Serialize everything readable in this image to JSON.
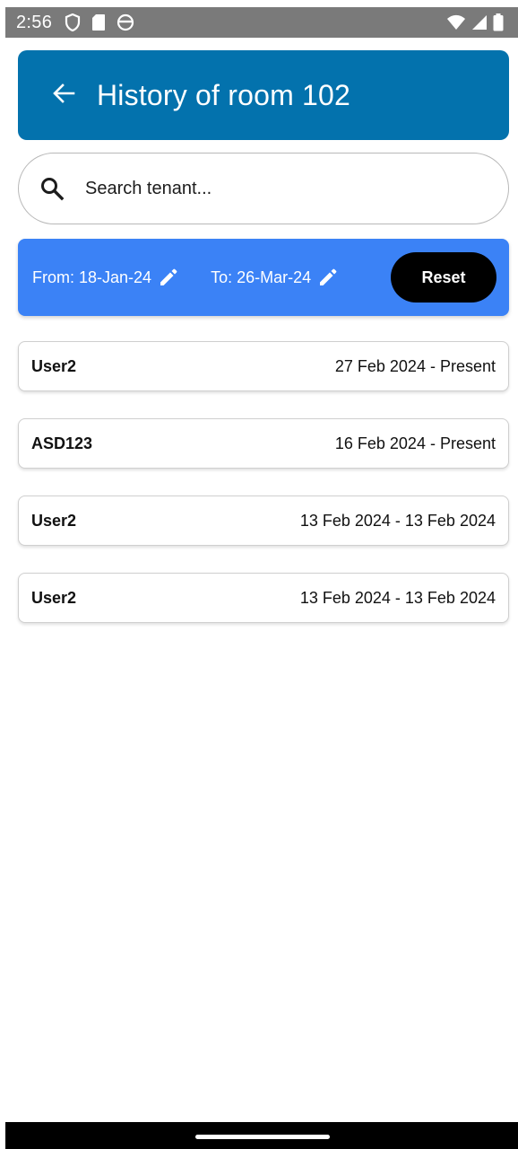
{
  "status_bar": {
    "time": "2:56",
    "left_icons": [
      "shield-icon",
      "sd-card-icon",
      "circle-face-icon"
    ],
    "right_icons": [
      "wifi-icon",
      "signal-icon",
      "battery-icon"
    ]
  },
  "app_bar": {
    "title": "History of room 102",
    "back_icon": "arrow-back-icon",
    "color": "#0372ad"
  },
  "search": {
    "placeholder": "Search tenant...",
    "value": "",
    "icon": "search-icon"
  },
  "filter": {
    "from_label": "From: 18-Jan-24",
    "to_label": "To: 26-Mar-24",
    "reset_label": "Reset",
    "background": "#3b82f6"
  },
  "tenants": [
    {
      "name": "User2",
      "range": "27 Feb 2024 - Present"
    },
    {
      "name": "ASD123",
      "range": "16 Feb 2024 - Present"
    },
    {
      "name": "User2",
      "range": "13 Feb 2024 - 13 Feb 2024"
    },
    {
      "name": "User2",
      "range": "13 Feb 2024 - 13 Feb 2024"
    }
  ]
}
